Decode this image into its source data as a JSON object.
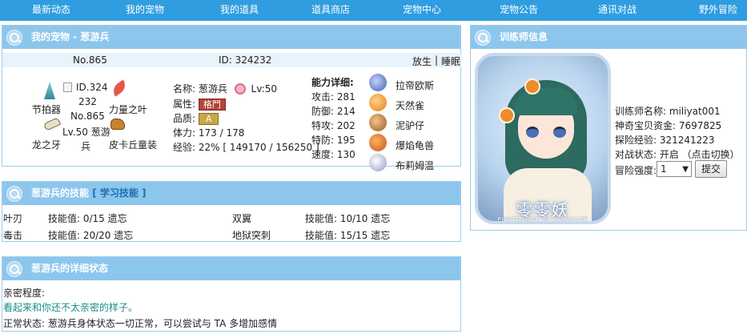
{
  "nav": {
    "items": [
      "最新动态",
      "我的宠物",
      "我的道具",
      "道具商店",
      "宠物中心",
      "宠物公告",
      "通讯对战",
      "野外冒险"
    ]
  },
  "pet_panel": {
    "title": "我的宠物 - 葱游兵",
    "number": "No.865",
    "id": "ID: 324232",
    "release_label": "放生",
    "separator": "|",
    "sleep_label": "睡眠",
    "items": {
      "metronome": "节拍器",
      "power_herb": "力量之叶",
      "dragon_fang": "龙之牙",
      "pikachu_costume": "皮卡丘童装"
    },
    "image_alt": {
      "line1": "ID.324",
      "line2": "232",
      "line3": "No.865",
      "line4": "Lv.50 葱游",
      "line5": "兵"
    },
    "name_label": "名称:",
    "name": "葱游兵",
    "level": "Lv:50",
    "attr_label": "属性:",
    "attr": "格鬥",
    "quality_label": "品质:",
    "quality": "A",
    "hp_label": "体力:",
    "hp": "173 / 178",
    "exp_label": "经验:",
    "exp": "22% [ 149170 / 156250 ]",
    "stats_title": "能力详细:",
    "stats": [
      {
        "label": "攻击:",
        "value": "281"
      },
      {
        "label": "防御:",
        "value": "214"
      },
      {
        "label": "特攻:",
        "value": "202"
      },
      {
        "label": "特防:",
        "value": "195"
      },
      {
        "label": "速度:",
        "value": "130"
      }
    ],
    "team": [
      "拉帝欧斯",
      "天然雀",
      "泥驴仔",
      "爆焰龟兽",
      "布莉姆温"
    ]
  },
  "skills_panel": {
    "title": "葱游兵的技能",
    "learn_label": "[ 学习技能 ]",
    "skills": [
      {
        "name": "叶刃",
        "value": "技能值: 0/15 遗忘"
      },
      {
        "name": "双翼",
        "value": "技能值: 10/10 遗忘"
      },
      {
        "name": "毒击",
        "value": "技能值: 20/20 遗忘"
      },
      {
        "name": "地狱突刺",
        "value": "技能值: 15/15 遗忘"
      }
    ]
  },
  "status_panel": {
    "title": "葱游兵的详细状态",
    "intimacy_label": "亲密程度:",
    "intimacy_text": "看起来和你还不太亲密的样子。",
    "status_line": "正常状态: 葱游兵身体状态一切正常，可以尝试与 TA 多增加感情"
  },
  "trainer_panel": {
    "title": "训练师信息",
    "avatar_signature": "零零妖",
    "avatar_credit": "PHOTOSHOP·BY·YUKIKAZE",
    "name": "训练师名称: miliyat001",
    "money": "神奇宝贝资金: 7697825",
    "exp": "探险经验: 321241223",
    "battle": "对战状态: 开启 （点击切换）",
    "difficulty_label": "冒险强度:",
    "difficulty_value": "1",
    "submit_label": "提交"
  },
  "colors": {
    "nav": "#2f9de0",
    "panel_head": "#8cc6ed",
    "accent_text": "#1a8a8a"
  }
}
